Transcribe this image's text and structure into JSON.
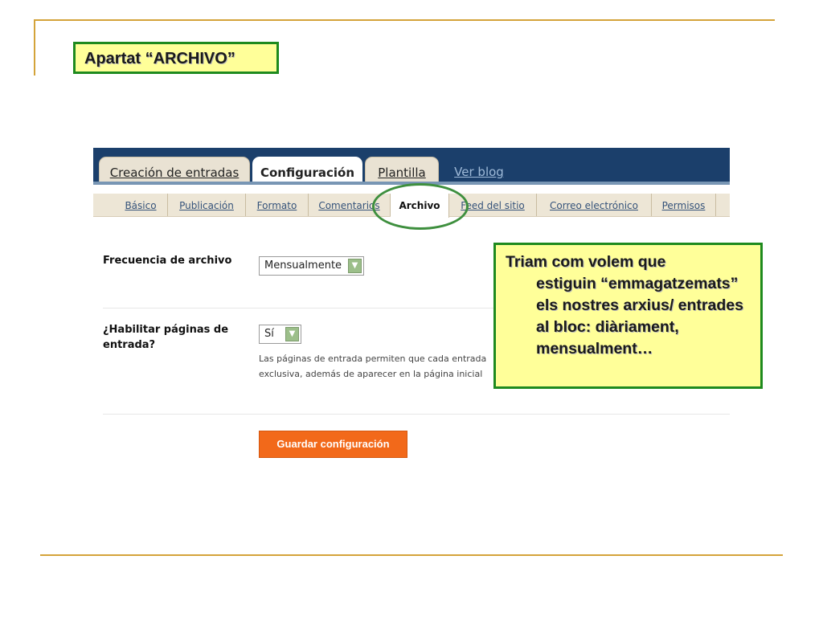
{
  "slide": {
    "title": "Apartat “ARCHIVO”",
    "note_first_line": "Triam com volem que",
    "note_rest": "estiguin “emmagatzemats” els nostres arxius/ entrades al bloc: diàriament, mensualment…",
    "accent_color": "#1e8a1e",
    "box_fill": "#ffff99"
  },
  "tabs": [
    "Creación de entradas",
    "Configuración",
    "Plantilla",
    "Ver blog"
  ],
  "subnav": [
    "Básico",
    "Publicación",
    "Formato",
    "Comentarios",
    "Archivo",
    "Feed del sitio",
    "Correo electrónico",
    "Permisos"
  ],
  "form": {
    "archive_frequency_label": "Frecuencia de archivo",
    "archive_frequency_value": "Mensualmente",
    "post_pages_label_1": "¿Habilitar páginas de",
    "post_pages_label_2": "entrada?",
    "post_pages_value": "Sí",
    "help_line_1": "Las páginas de entrada permiten que cada entrada",
    "help_line_2": "exclusiva, además de aparecer en la página inicial",
    "save_button": "Guardar configuración"
  }
}
